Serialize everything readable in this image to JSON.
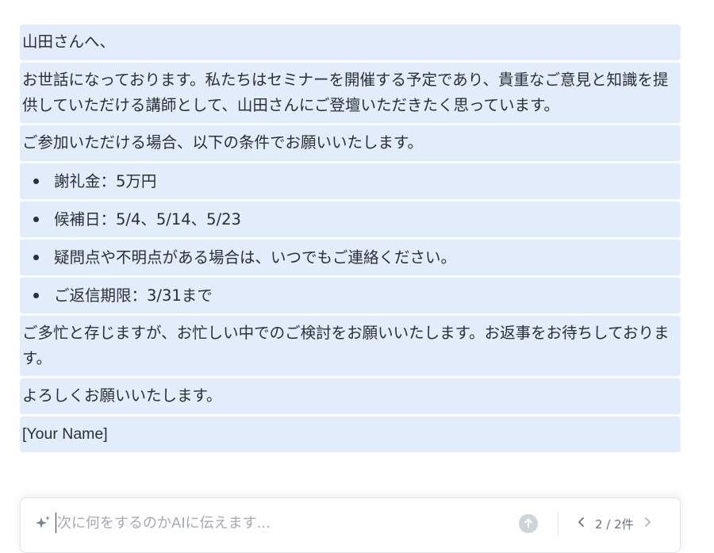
{
  "document": {
    "greeting": "山田さんへ、",
    "intro": "お世話になっております。私たちはセミナーを開催する予定であり、貴重なご意見と知識を提供していただける講師として、山田さんにご登壇いただきたく思っています。",
    "conditions_lead": "ご参加いただける場合、以下の条件でお願いいたします。",
    "bullets": [
      "謝礼金：5万円",
      "候補日：5/4、5/14、5/23",
      "疑問点や不明点がある場合は、いつでもご連絡ください。",
      "ご返信期限：3/31まで"
    ],
    "closing": "ご多忙と存じますが、お忙しい中でのご検討をお願いいたします。お返事をお待ちしております。",
    "regards": "よろしくお願いいたします。",
    "signature": "[Your Name]"
  },
  "ai_prompt": {
    "placeholder": "次に何をするのかAIに伝えます...",
    "value": "",
    "pager_text": "2 / 2件",
    "icons": {
      "left": "sparkle-icon",
      "send": "arrow-up-icon",
      "prev": "chevron-left-icon",
      "next": "chevron-right-icon"
    }
  },
  "colors": {
    "block_background": "#e2ecfb",
    "text": "#2b2f36",
    "placeholder": "#a4a9b3",
    "send_button": "#cfd3da"
  }
}
